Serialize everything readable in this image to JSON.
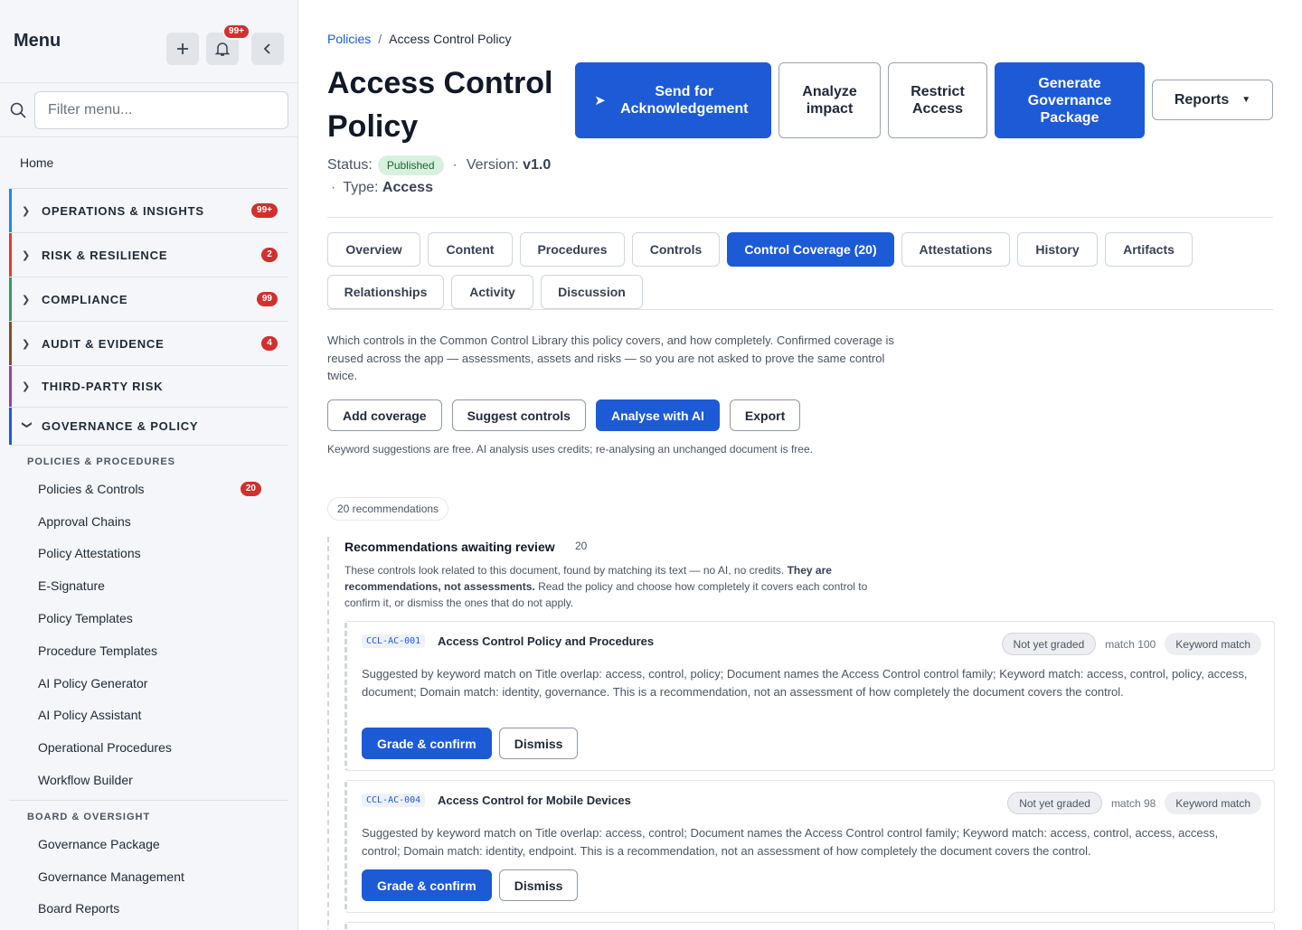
{
  "sidebar": {
    "title": "Menu",
    "notif_count": "99+",
    "filter_placeholder": "Filter menu...",
    "home": "Home",
    "sections": [
      {
        "label": "OPERATIONS & INSIGHTS",
        "count": "99+",
        "color": "#1e88e5"
      },
      {
        "label": "RISK & RESILIENCE",
        "count": "2",
        "color": "#e53935"
      },
      {
        "label": "COMPLIANCE",
        "count": "99",
        "color": "#2e9e6b"
      },
      {
        "label": "AUDIT & EVIDENCE",
        "count": "4",
        "color": "#8a4a2b"
      },
      {
        "label": "THIRD-PARTY RISK",
        "count": "",
        "color": "#8e44ad"
      },
      {
        "label": "GOVERNANCE & POLICY",
        "count": "",
        "color": "#1d5ad6"
      }
    ],
    "group1": "POLICIES & PROCEDURES",
    "group1_items": [
      {
        "label": "Policies & Controls",
        "count": "20"
      },
      {
        "label": "Approval Chains"
      },
      {
        "label": "Policy Attestations"
      },
      {
        "label": "E-Signature"
      },
      {
        "label": "Policy Templates"
      },
      {
        "label": "Procedure Templates"
      },
      {
        "label": "AI Policy Generator"
      },
      {
        "label": "AI Policy Assistant"
      },
      {
        "label": "Operational Procedures"
      },
      {
        "label": "Workflow Builder"
      }
    ],
    "group2": "BOARD & OVERSIGHT",
    "group2_items": [
      {
        "label": "Governance Package"
      },
      {
        "label": "Governance Management"
      },
      {
        "label": "Board Reports"
      }
    ]
  },
  "breadcrumb": {
    "parent": "Policies",
    "separator": "/",
    "current": "Access Control Policy"
  },
  "page": {
    "title": "Access Control Policy",
    "status_label": "Status:",
    "status": "Published",
    "version_label": "Version:",
    "version": "v1.0",
    "type_label": "Type:",
    "type": "Access"
  },
  "header_buttons": {
    "send": "Send for Acknowledgement",
    "analyze": "Analyze impact",
    "restrict": "Restrict Access",
    "generate": "Generate Governance Package",
    "reports": "Reports"
  },
  "tabs": [
    {
      "label": "Overview"
    },
    {
      "label": "Content"
    },
    {
      "label": "Procedures"
    },
    {
      "label": "Controls"
    },
    {
      "label": "Control Coverage (20)"
    },
    {
      "label": "Attestations"
    },
    {
      "label": "History"
    },
    {
      "label": "Artifacts"
    },
    {
      "label": "Relationships"
    },
    {
      "label": "Activity"
    },
    {
      "label": "Discussion"
    }
  ],
  "coverage": {
    "description": "Which controls in the Common Control Library this policy covers, and how completely. Confirmed coverage is reused across the app — assessments, assets and risks — so you are not asked to prove the same control twice.",
    "actions": {
      "add": "Add coverage",
      "suggest": "Suggest controls",
      "analyse": "Analyse with AI",
      "export": "Export"
    },
    "note": "Keyword suggestions are free. AI analysis uses credits; re-analysing an unchanged document is free.",
    "rec_pill": "20 recommendations",
    "review_title": "Recommendations awaiting review",
    "review_count": "20",
    "review_desc_1": "These controls look related to this document, found by matching its text — no AI, no credits. ",
    "review_desc_bold": "They are recommendations, not assessments.",
    "review_desc_2": " Read the policy and choose how completely it covers each control to confirm it, or dismiss the ones that do not apply.",
    "cards": [
      {
        "code": "CCL-AC-001",
        "title": "Access Control Policy and Procedures",
        "grade": "Not yet graded",
        "match": "match 100",
        "source": "Keyword match",
        "body": "Suggested by keyword match on Title overlap: access, control, policy; Document names the Access Control control family; Keyword match: access, control, policy, access, document; Domain match: identity, governance. This is a recommendation, not an assessment of how completely the document covers the control.",
        "confirm": "Grade & confirm",
        "dismiss": "Dismiss"
      },
      {
        "code": "CCL-AC-004",
        "title": "Access Control for Mobile Devices",
        "grade": "Not yet graded",
        "match": "match 98",
        "source": "Keyword match",
        "body": "Suggested by keyword match on Title overlap: access, control; Document names the Access Control control family; Keyword match: access, control, access, access, control; Domain match: identity, endpoint. This is a recommendation, not an assessment of how completely the document covers the control.",
        "confirm": "Grade & confirm",
        "dismiss": "Dismiss"
      }
    ]
  },
  "colors": {
    "primary": "#1d5ad6",
    "badge": "#d32f2f",
    "published_bg": "#d8f1de"
  }
}
